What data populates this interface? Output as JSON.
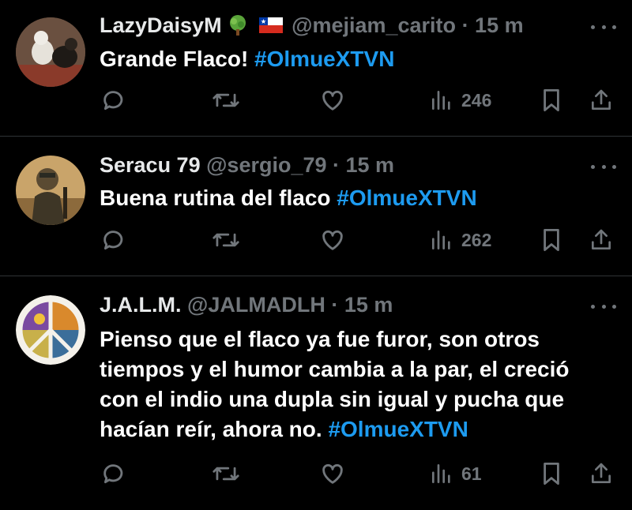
{
  "tweets": [
    {
      "display_name": "LazyDaisyM",
      "handle": "@mejiam_carito",
      "time": "· 15 m",
      "text": "Grande Flaco! ",
      "hashtag": "#OlmueXTVN",
      "views": "246"
    },
    {
      "display_name": "Seracu 79",
      "handle": "@sergio_79",
      "time": "· 15 m",
      "text": "Buena rutina del flaco ",
      "hashtag": "#OlmueXTVN",
      "views": "262"
    },
    {
      "display_name": "J.A.L.M.",
      "handle": "@JALMADLH",
      "time": "· 15 m",
      "text": "Pienso que el flaco ya fue furor, son otros tiempos y el humor cambia a la par, el creció con el indio una dupla sin igual y pucha que hacían reír, ahora no. ",
      "hashtag": "#OlmueXTVN",
      "views": "61"
    }
  ],
  "icons": {
    "reply": "reply-icon",
    "retweet": "retweet-icon",
    "like": "like-icon",
    "views": "views-icon",
    "bookmark": "bookmark-icon",
    "share": "share-icon",
    "more": "more-icon"
  },
  "colors": {
    "background": "#000000",
    "text": "#e7e9ea",
    "muted": "#71767b",
    "link": "#1d9bf0",
    "divider": "#2f3336"
  }
}
